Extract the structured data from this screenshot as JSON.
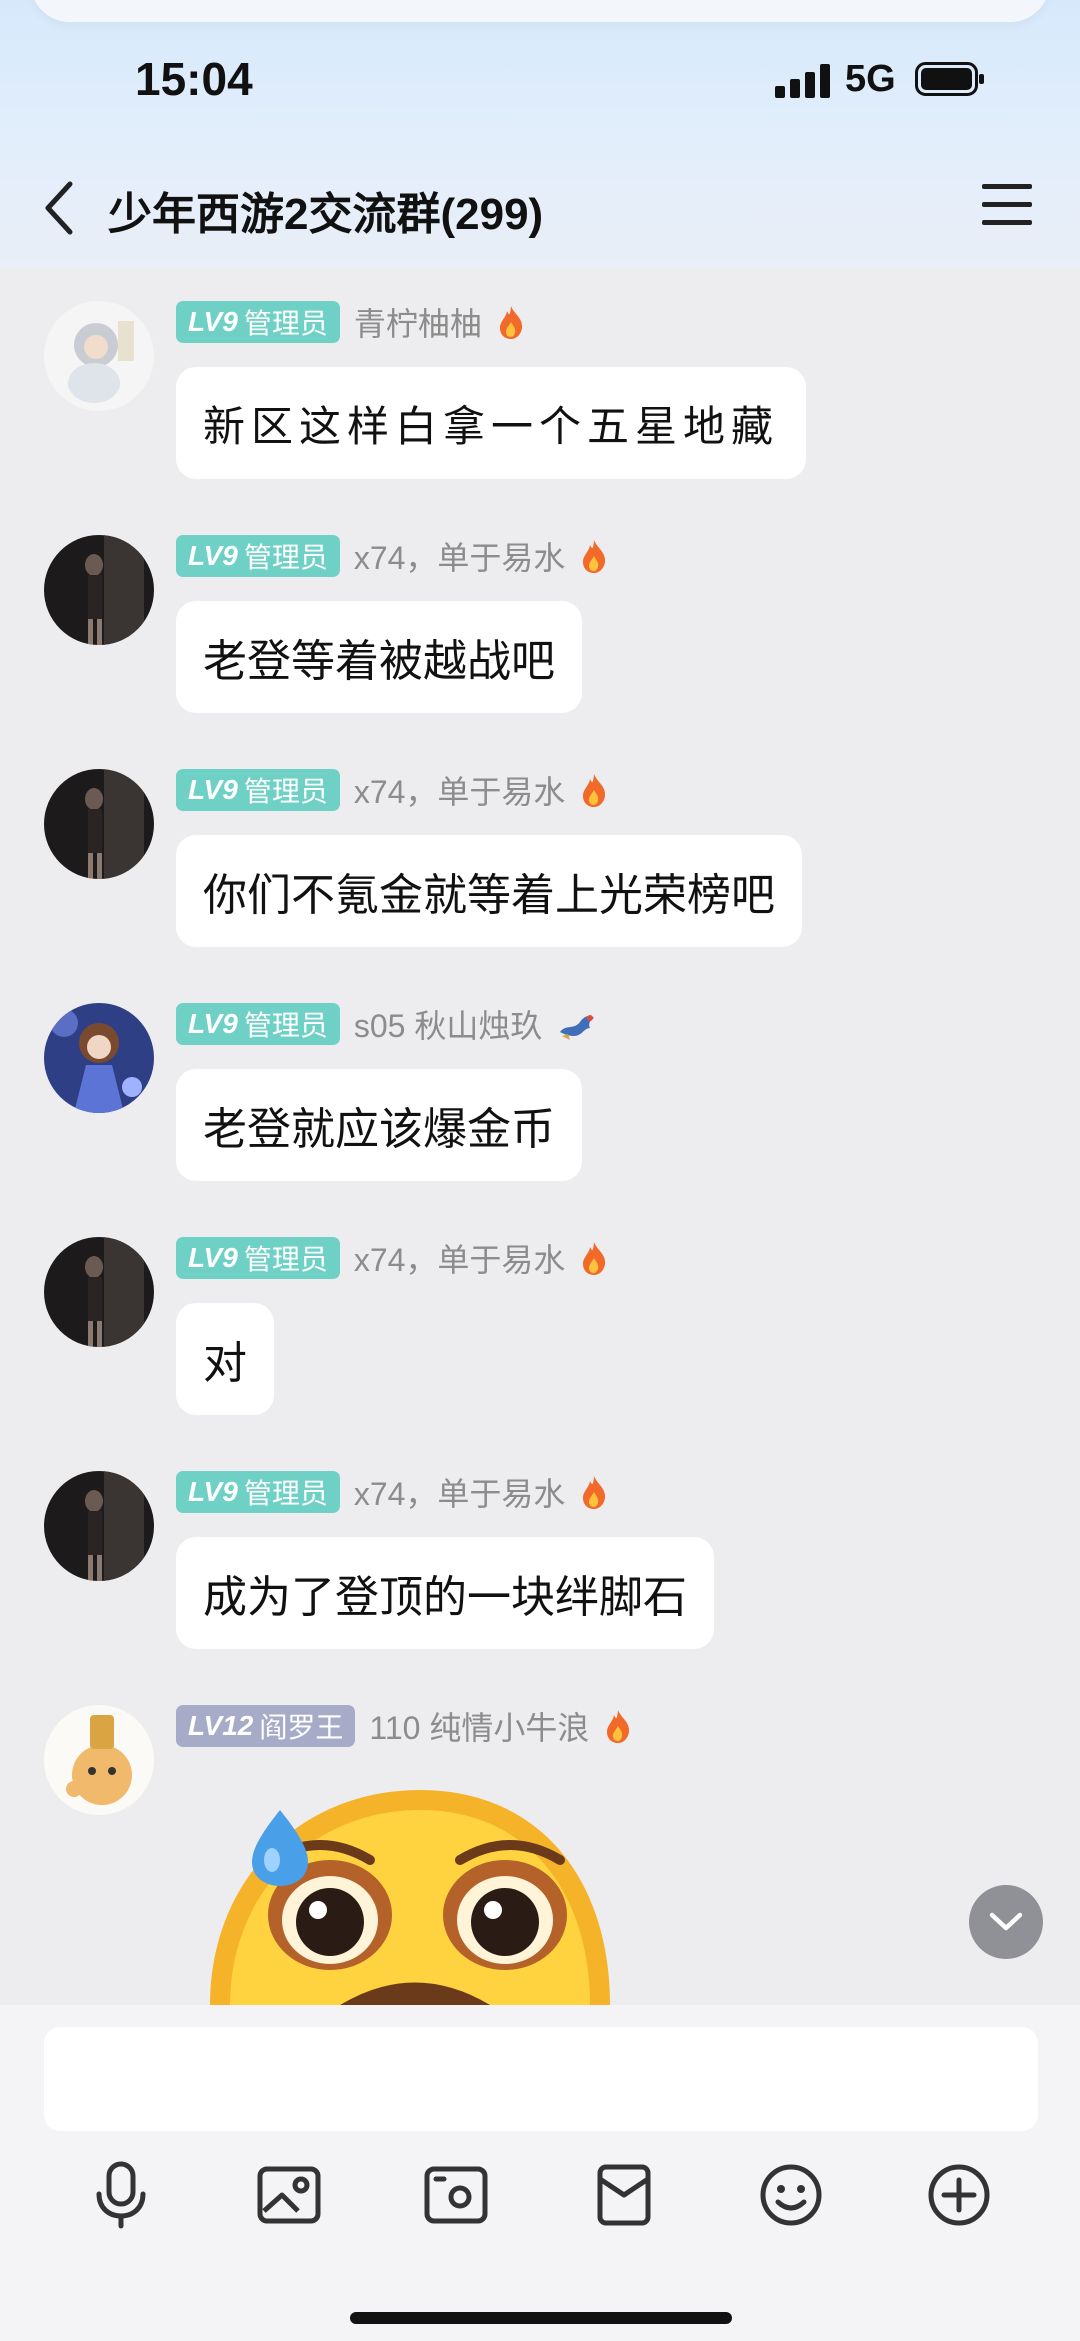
{
  "status_bar": {
    "time": "15:04",
    "network": "5G"
  },
  "header": {
    "title": "少年西游2交流群(299)"
  },
  "messages": [
    {
      "level": "LV9",
      "role": "管理员",
      "sender": "青柠柚柚",
      "text": "新区这样白拿一个五星地藏",
      "level_color": "#6fd1c6"
    },
    {
      "level": "LV9",
      "role": "管理员",
      "sender": "x74，单于易水",
      "text": "老登等着被越战吧",
      "level_color": "#6fd1c6"
    },
    {
      "level": "LV9",
      "role": "管理员",
      "sender": "x74，单于易水",
      "text": "你们不氪金就等着上光荣榜吧",
      "level_color": "#6fd1c6"
    },
    {
      "level": "LV9",
      "role": "管理员",
      "sender": "s05 秋山烛玖",
      "text": "老登就应该爆金币",
      "level_color": "#6fd1c6"
    },
    {
      "level": "LV9",
      "role": "管理员",
      "sender": "x74，单于易水",
      "text": "对",
      "level_color": "#6fd1c6"
    },
    {
      "level": "LV9",
      "role": "管理员",
      "sender": "x74，单于易水",
      "text": "成为了登顶的一块绊脚石",
      "level_color": "#6fd1c6"
    },
    {
      "level": "LV12",
      "role": "阎罗王",
      "sender": "110 纯情小牛浪",
      "text": "",
      "level_color": "#a6abc7"
    }
  ],
  "icons": {
    "back": "chevron-left-icon",
    "menu": "menu-icon",
    "fire": "fire-icon",
    "dragon": "dragon-icon",
    "scroll_down": "chevron-down-icon",
    "toolbar": [
      "microphone-icon",
      "image-icon",
      "camera-icon",
      "red-packet-icon",
      "emoji-icon",
      "plus-icon"
    ]
  },
  "colors": {
    "accent_teal": "#6fd1c6",
    "badge_grey": "#a6abc7",
    "background": "#ededf0"
  }
}
